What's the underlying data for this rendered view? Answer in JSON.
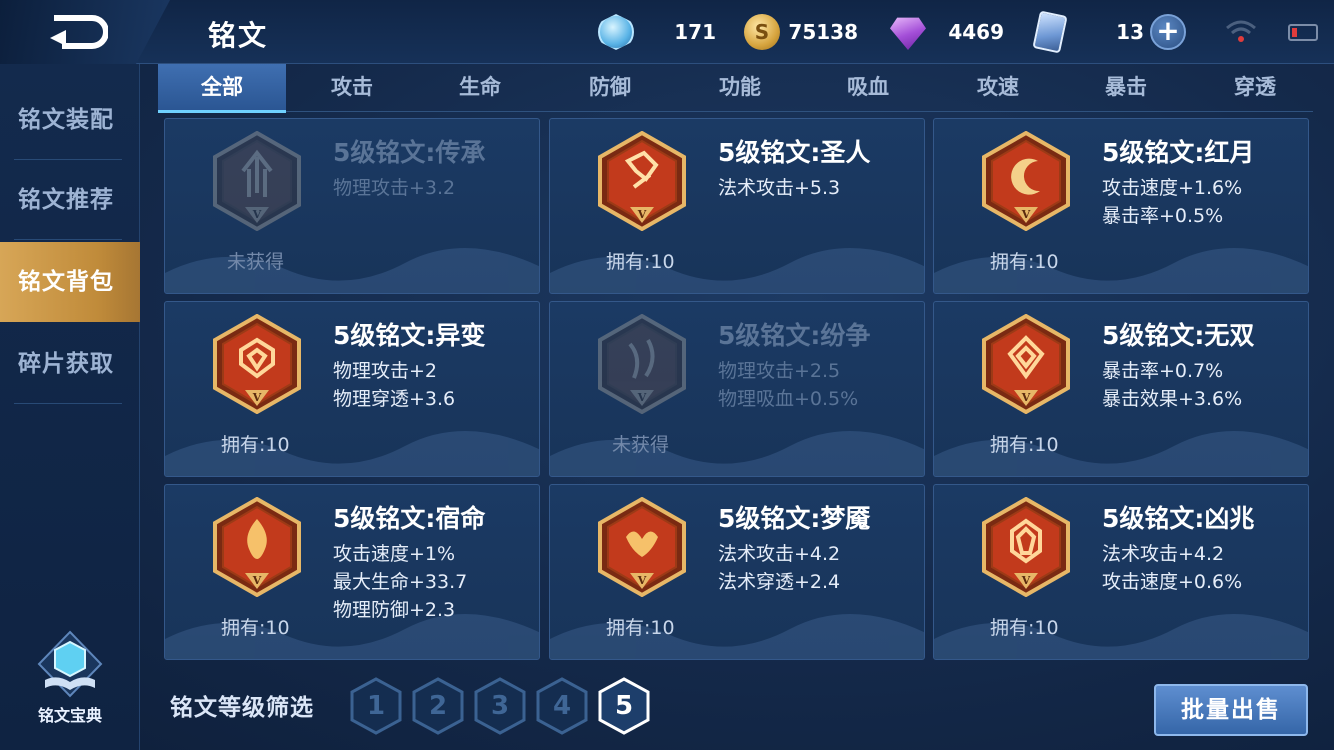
{
  "header": {
    "title": "铭文"
  },
  "resources": [
    {
      "icon": "crystal-icon",
      "value": "171"
    },
    {
      "icon": "gold-coin-icon",
      "value": "75138"
    },
    {
      "icon": "diamond-icon",
      "value": "4469"
    },
    {
      "icon": "ticket-card-icon",
      "value": "13"
    }
  ],
  "sidebar": {
    "items": [
      {
        "label": "铭文装配"
      },
      {
        "label": "铭文推荐"
      },
      {
        "label": "铭文背包",
        "active": true
      },
      {
        "label": "碎片获取"
      }
    ],
    "codex_label": "铭文宝典"
  },
  "tabs": [
    {
      "label": "全部",
      "active": true
    },
    {
      "label": "攻击"
    },
    {
      "label": "生命"
    },
    {
      "label": "防御"
    },
    {
      "label": "功能"
    },
    {
      "label": "吸血"
    },
    {
      "label": "攻速"
    },
    {
      "label": "暴击"
    },
    {
      "label": "穿透"
    }
  ],
  "cards": [
    {
      "name": "5级铭文:传承",
      "attrs": [
        "物理攻击+3.2"
      ],
      "status": "未获得",
      "locked": true
    },
    {
      "name": "5级铭文:圣人",
      "attrs": [
        "法术攻击+5.3"
      ],
      "status": "拥有:10"
    },
    {
      "name": "5级铭文:红月",
      "attrs": [
        "攻击速度+1.6%",
        "暴击率+0.5%"
      ],
      "status": "拥有:10"
    },
    {
      "name": "5级铭文:异变",
      "attrs": [
        "物理攻击+2",
        "物理穿透+3.6"
      ],
      "status": "拥有:10"
    },
    {
      "name": "5级铭文:纷争",
      "attrs": [
        "物理攻击+2.5",
        "物理吸血+0.5%"
      ],
      "status": "未获得",
      "locked": true
    },
    {
      "name": "5级铭文:无双",
      "attrs": [
        "暴击率+0.7%",
        "暴击效果+3.6%"
      ],
      "status": "拥有:10"
    },
    {
      "name": "5级铭文:宿命",
      "attrs": [
        "攻击速度+1%",
        "最大生命+33.7",
        "物理防御+2.3"
      ],
      "status": "拥有:10"
    },
    {
      "name": "5级铭文:梦魇",
      "attrs": [
        "法术攻击+4.2",
        "法术穿透+2.4"
      ],
      "status": "拥有:10"
    },
    {
      "name": "5级铭文:凶兆",
      "attrs": [
        "法术攻击+4.2",
        "攻击速度+0.6%"
      ],
      "status": "拥有:10"
    }
  ],
  "rune_badge_letter": "V",
  "filter": {
    "label": "铭文等级筛选",
    "levels": [
      "1",
      "2",
      "3",
      "4",
      "5"
    ],
    "selected": "5"
  },
  "sell_button": "批量出售",
  "colors": {
    "accent_gold": "#c9973f",
    "tab_active": "#3f6fb1",
    "rune_red": "#c23a1c",
    "rune_border": "#e7b767"
  }
}
